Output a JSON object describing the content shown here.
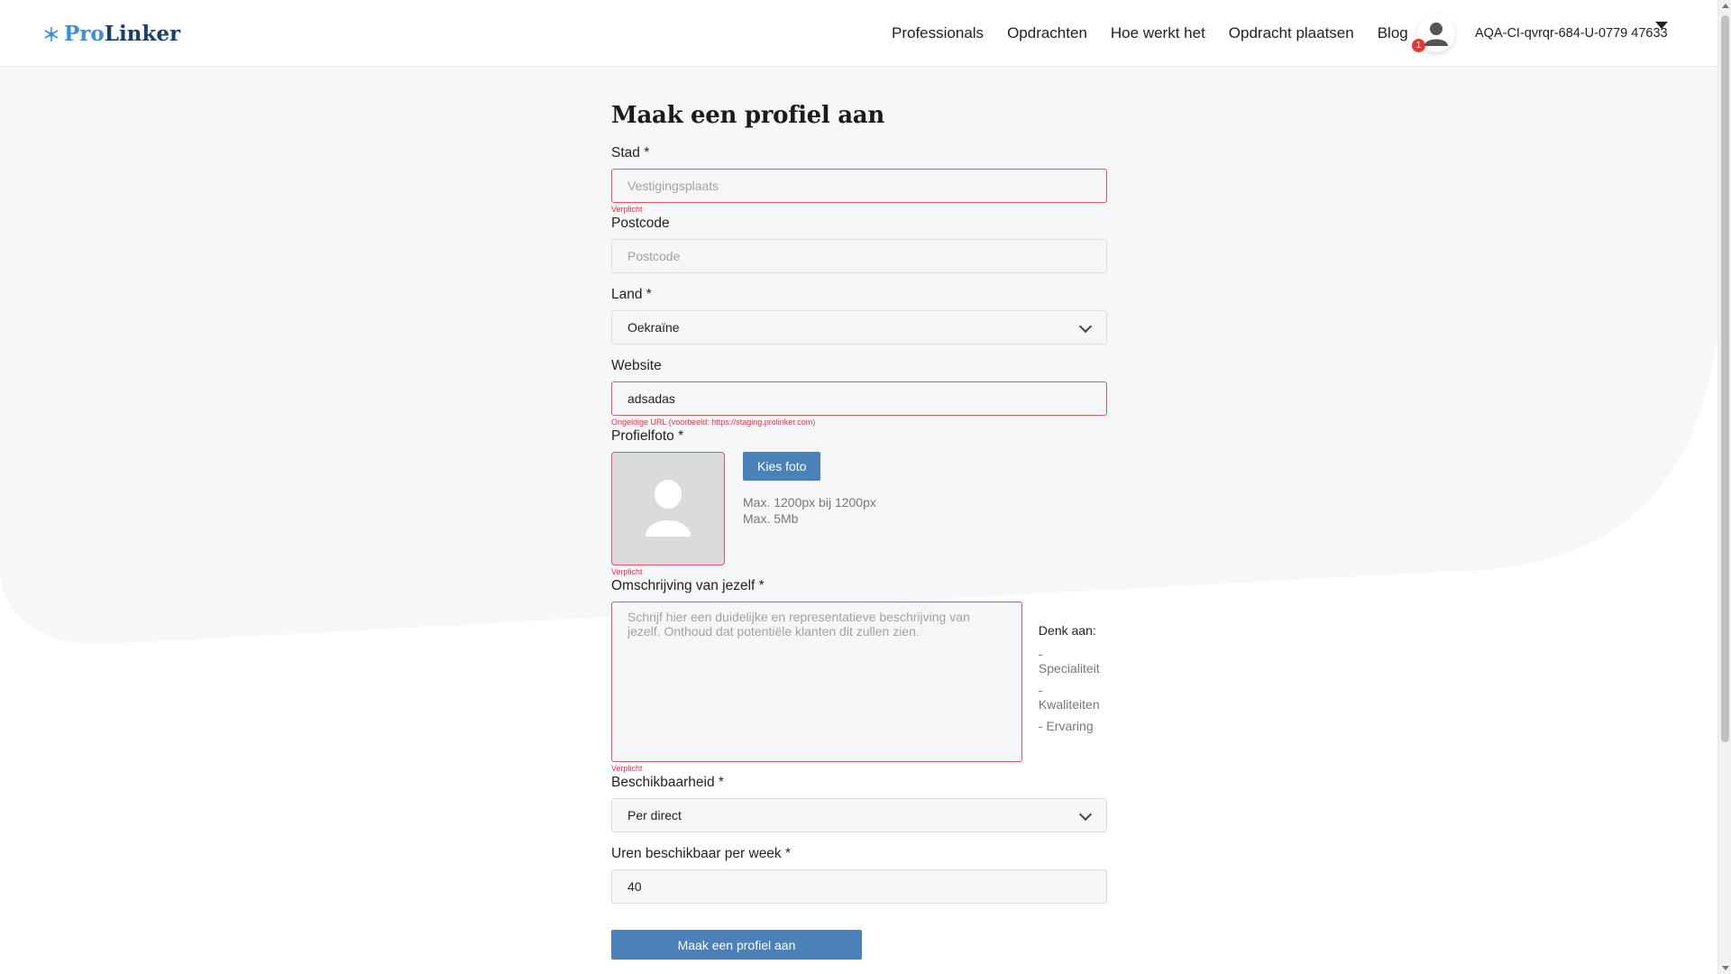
{
  "header": {
    "logo_pro": "Pro",
    "logo_linker": "Linker",
    "nav": [
      "Professionals",
      "Opdrachten",
      "Hoe werkt het",
      "Opdracht plaatsen",
      "Blog"
    ],
    "notification_count": "1",
    "user_name": "AQA-CI-qvrqr-684-U-0779 47633"
  },
  "form": {
    "title": "Maak een profiel aan",
    "city": {
      "label": "Stad *",
      "placeholder": "Vestigingsplaats",
      "value": "",
      "error": "Verplicht"
    },
    "postcode": {
      "label": "Postcode",
      "placeholder": "Postcode",
      "value": ""
    },
    "country": {
      "label": "Land *",
      "value": "Oekraïne"
    },
    "website": {
      "label": "Website",
      "value": "adsadas",
      "error": "Ongeldige URL (voorbeeld: https://staging.prolinker.com)"
    },
    "photo": {
      "label": "Profielfoto *",
      "button": "Kies foto",
      "info1": "Max. 1200px bij 1200px",
      "info2": "Max. 5Mb",
      "error": "Verplicht"
    },
    "description": {
      "label": "Omschrijving van jezelf *",
      "placeholder": "Schrijf hier een duidelijke en representatieve beschrijving van jezelf. Onthoud dat potentiële klanten dit zullen zien.",
      "error": "Verplicht",
      "hints_title": "Denk aan:",
      "hints": [
        "- Specialiteit",
        "- Kwaliteiten",
        "- Ervaring"
      ]
    },
    "availability": {
      "label": "Beschikbaarheid *",
      "value": "Per direct"
    },
    "hours": {
      "label": "Uren beschikbaar per week *",
      "value": "40"
    },
    "submit": "Maak een profiel aan"
  },
  "colors": {
    "accent": "#4a81b8",
    "error": "#e05560",
    "logo_light": "#3b8fd6",
    "logo_dark": "#1a3f6b"
  }
}
